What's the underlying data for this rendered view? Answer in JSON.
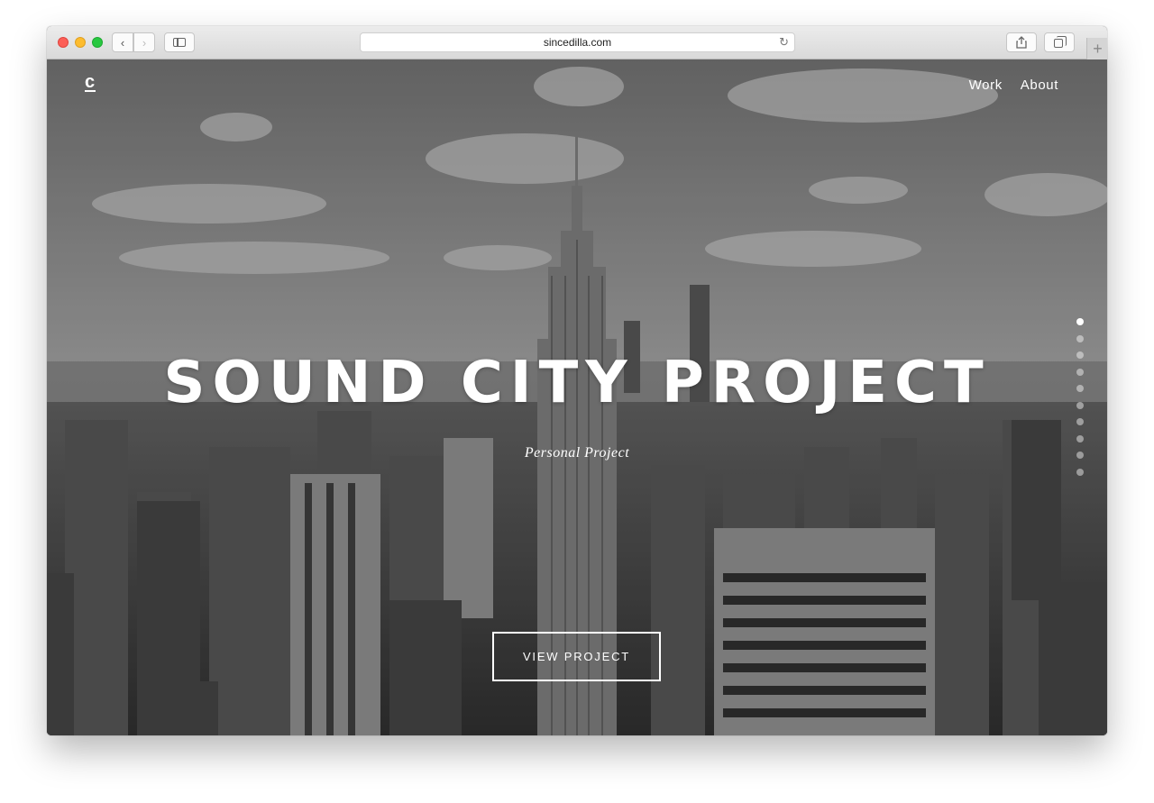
{
  "browser": {
    "url": "sincedilla.com",
    "icons": {
      "back": "chevron-left-icon",
      "forward": "chevron-right-icon",
      "sidebar": "sidebar-icon",
      "reload": "reload-icon",
      "share": "share-icon",
      "tabs": "tabs-icon",
      "new_tab": "plus-icon"
    }
  },
  "site": {
    "logo": "c",
    "nav": {
      "work": "Work",
      "about": "About"
    }
  },
  "hero": {
    "title": "SOUND CITY PROJECT",
    "subtitle": "Personal Project",
    "cta": "VIEW PROJECT",
    "slides": {
      "total": 10,
      "active": 1
    }
  },
  "colors": {
    "text": "#ffffff",
    "traffic_red": "#fc5f57",
    "traffic_yellow": "#fdbc2e",
    "traffic_green": "#28c840"
  }
}
